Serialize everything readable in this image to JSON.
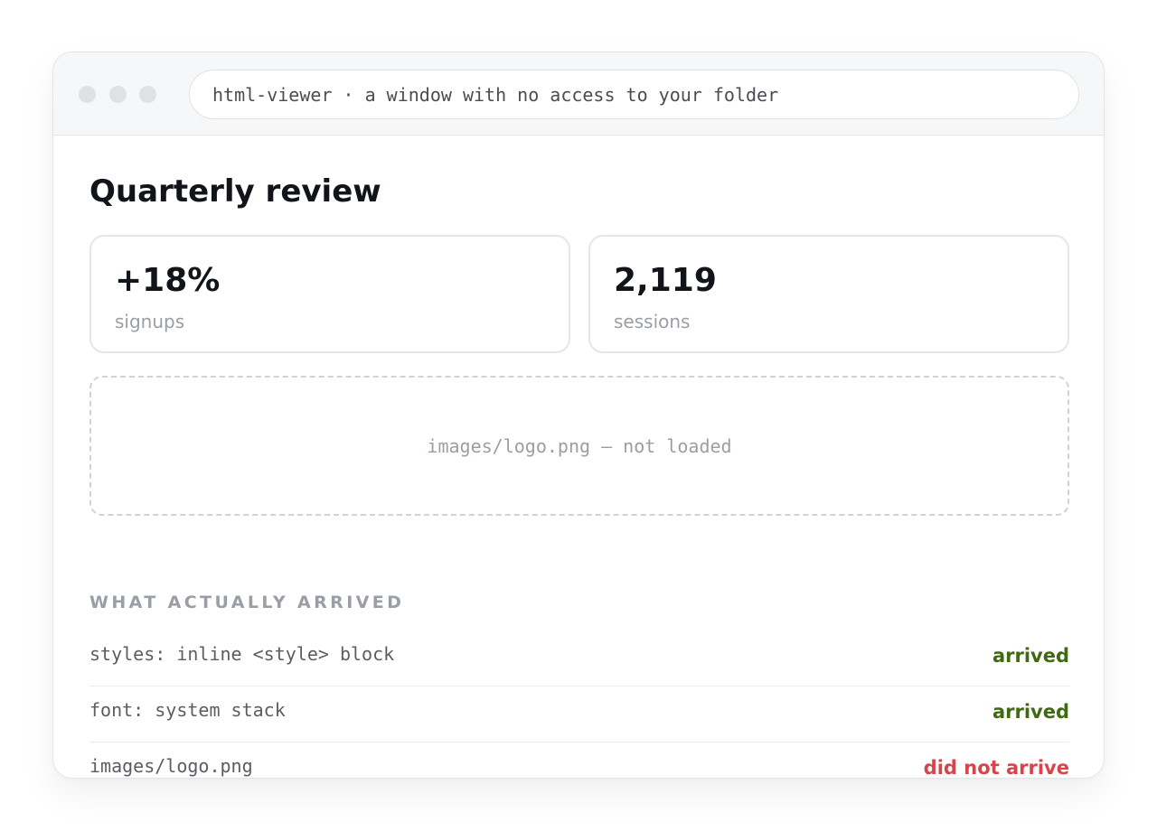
{
  "window": {
    "address": "html-viewer · a window with no access to your folder"
  },
  "page": {
    "title": "Quarterly review"
  },
  "stats": [
    {
      "value": "+18%",
      "label": "signups"
    },
    {
      "value": "2,119",
      "label": "sessions"
    }
  ],
  "image_placeholder": {
    "text": "images/logo.png — not loaded"
  },
  "arrivals": {
    "heading": "WHAT ACTUALLY ARRIVED",
    "rows": [
      {
        "label": "styles: inline <style> block",
        "status": "arrived"
      },
      {
        "label": "font: system stack",
        "status": "arrived"
      },
      {
        "label": "images/logo.png",
        "status": "did not arrive"
      }
    ]
  },
  "colors": {
    "arrived": "#3f6a12",
    "did_not_arrive": "#d6454b"
  }
}
